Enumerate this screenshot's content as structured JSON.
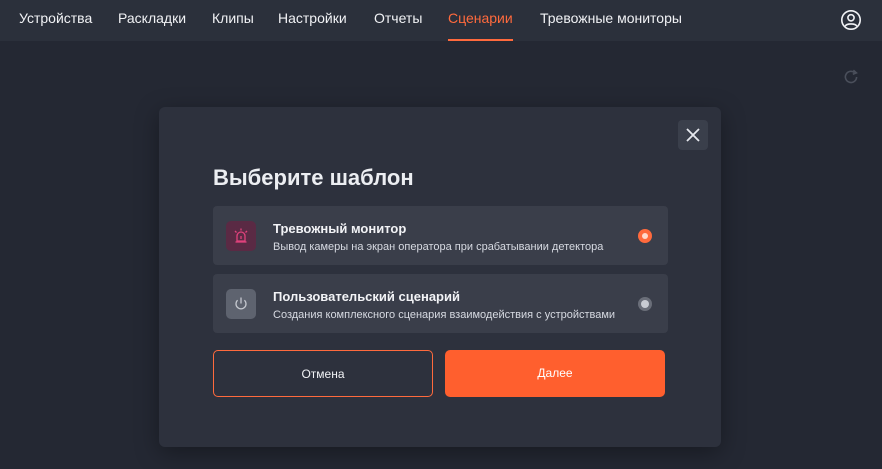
{
  "nav": {
    "items": [
      {
        "label": "Устройства",
        "active": false
      },
      {
        "label": "Раскладки",
        "active": false
      },
      {
        "label": "Клипы",
        "active": false
      },
      {
        "label": "Настройки",
        "active": false
      },
      {
        "label": "Отчеты",
        "active": false
      },
      {
        "label": "Сценарии",
        "active": true
      },
      {
        "label": "Тревожные мониторы",
        "active": false
      }
    ],
    "user_icon": "user-circle-icon"
  },
  "toolbar": {
    "refresh_icon": "refresh-icon"
  },
  "modal": {
    "title": "Выберите шаблон",
    "close_icon": "close-icon",
    "options": [
      {
        "title": "Тревожный монитор",
        "description": "Вывод камеры на экран оператора при срабатывании детектора",
        "icon": "siren-icon",
        "selected": true
      },
      {
        "title": "Пользовательский сценарий",
        "description": "Создания комплексного сценария взаимодействия с устройствами",
        "icon": "power-icon",
        "selected": false
      }
    ],
    "cancel_label": "Отмена",
    "next_label": "Далее"
  },
  "colors": {
    "accent": "#ff6a3d",
    "background": "#242833",
    "topbar": "#2b303b",
    "modal": "#2d313d",
    "option": "#3a3e4a"
  }
}
